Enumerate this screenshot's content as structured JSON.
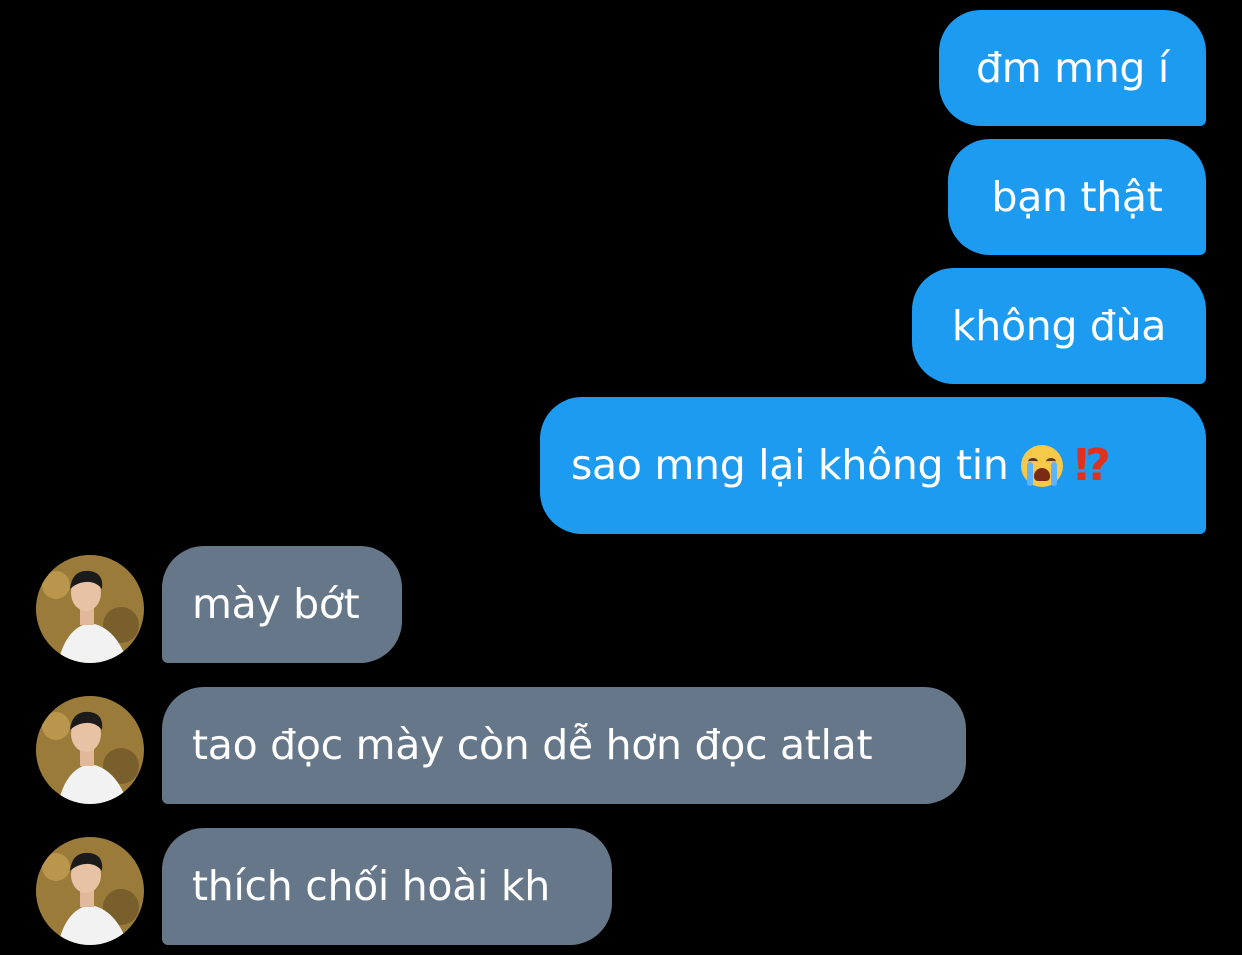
{
  "messages": [
    {
      "side": "sent",
      "text": "đm mng í"
    },
    {
      "side": "sent",
      "text": "bạn thật"
    },
    {
      "side": "sent",
      "text": "không đùa"
    },
    {
      "side": "sent",
      "text": "sao mng lại không tin",
      "emojis": [
        "loudly-crying-face",
        "exclamation-question-mark"
      ],
      "emoji_text": "⁉"
    },
    {
      "side": "received",
      "text": "mày bớt"
    },
    {
      "side": "received",
      "text": "tao đọc mày còn dễ hơn đọc atlat"
    },
    {
      "side": "received",
      "text": "thích chối hoài kh"
    }
  ],
  "colors": {
    "background": "#000000",
    "sent_bubble": "#1d9bf0",
    "received_bubble": "#66778a",
    "text": "#ffffff"
  }
}
